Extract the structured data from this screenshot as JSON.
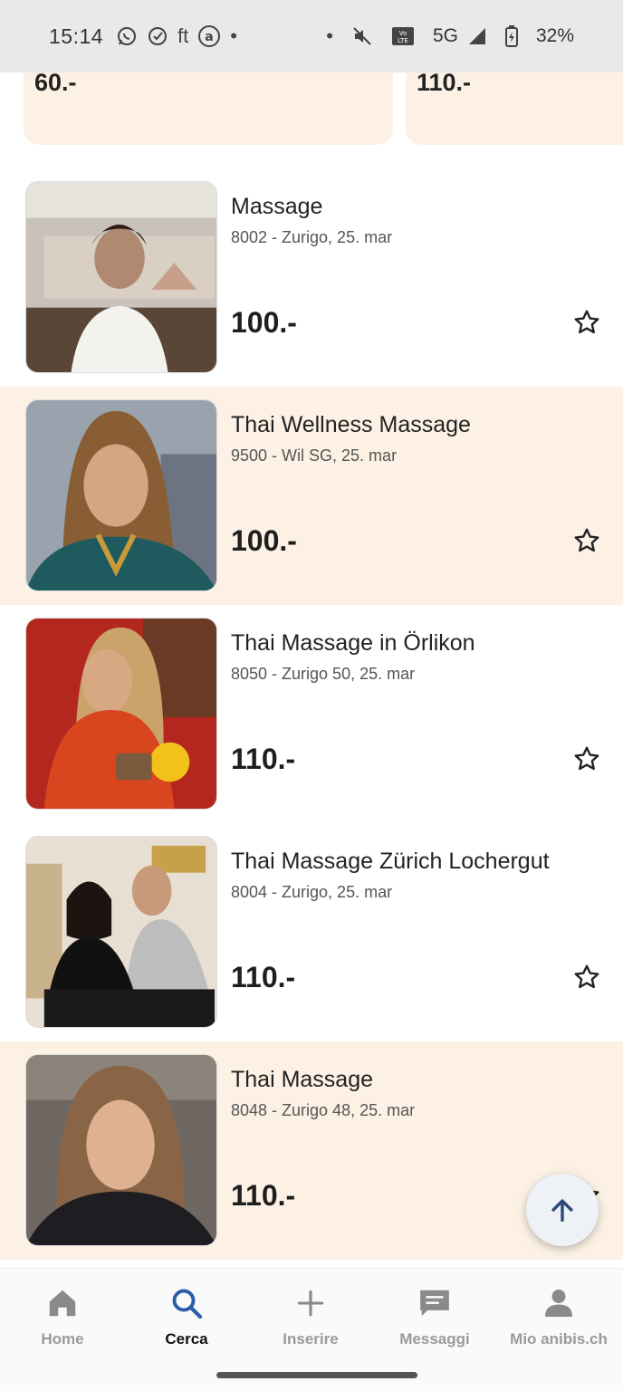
{
  "status_bar": {
    "time": "15:14",
    "left_icons": [
      "whatsapp-icon",
      "check-circle-icon",
      "ft-icon",
      "at-icon",
      "dot-icon"
    ],
    "ft_text": "ft",
    "network": "5G",
    "battery": "32%"
  },
  "top_partial_prices": [
    "60.-",
    "110.-"
  ],
  "listings": [
    {
      "title": "Massage",
      "location": "8002 - Zurigo, 25. mar",
      "price": "100.-"
    },
    {
      "title": "Thai Wellness Massage",
      "location": "9500 - Wil SG, 25. mar",
      "price": "100.-"
    },
    {
      "title": "Thai Massage in Örlikon",
      "location": "8050 - Zurigo 50, 25. mar",
      "price": "110.-"
    },
    {
      "title": "Thai Massage Zürich Lochergut",
      "location": "8004 - Zurigo, 25. mar",
      "price": "110.-"
    },
    {
      "title": "Thai Massage",
      "location": "8048 - Zurigo 48, 25. mar",
      "price": "110.-"
    }
  ],
  "nav": {
    "home": "Home",
    "search": "Cerca",
    "insert": "Inserire",
    "messages": "Messaggi",
    "profile": "Mio anibis.ch"
  },
  "colors": {
    "tint": "#fcf1e4",
    "accent": "#2b5ea8",
    "inactive": "#9a9a9a"
  }
}
